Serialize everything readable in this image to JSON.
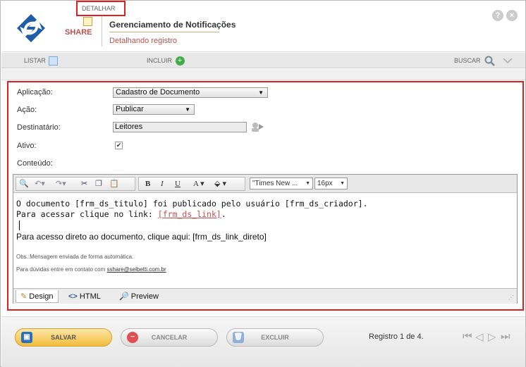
{
  "header": {
    "brand": "SHARE",
    "title": "Gerenciamento de Notificações",
    "subtitle": "Detalhando registro",
    "help_icon": "help-circle-icon",
    "close_icon": "close-circle-icon"
  },
  "toolbar": {
    "tabs": [
      {
        "label": "LISTAR",
        "icon": "list-icon"
      },
      {
        "label": "DETALHAR",
        "icon": "edit-document-icon"
      },
      {
        "label": "INCLUIR",
        "icon": "add-circle-icon"
      }
    ],
    "search_label": "BUSCAR"
  },
  "form": {
    "aplicacao_label": "Aplicação:",
    "aplicacao_value": "Cadastro de Documento",
    "acao_label": "Ação:",
    "acao_value": "Publicar",
    "destinatario_label": "Destinatário:",
    "destinatario_value": "Leitores",
    "ativo_label": "Ativo:",
    "ativo_checked": "✔",
    "conteudo_label": "Conteúdo:"
  },
  "editor": {
    "font_select": "\"Times New ...",
    "size_select": "16px",
    "line1": "O documento [frm_ds_titulo] foi publicado pelo usuário [frm_ds_criador].",
    "line2_prefix": "Para acessar clique no link: ",
    "line2_link": "[frm_ds_link]",
    "line2_suffix": ".",
    "line4": "Para acesso direto ao documento, clique aqui: [frm_ds_link_direto]",
    "obs": "Obs.:Mensagem enviada de forma automática.",
    "contact_prefix": "Para dúvidas entre em contato com ",
    "contact_email": "sshare@selbetti.com.br",
    "mode_design": "Design",
    "mode_html": "HTML",
    "mode_preview": "Preview"
  },
  "footer": {
    "save": "SALVAR",
    "cancel": "CANCELAR",
    "delete": "EXCLUIR",
    "records": "Registro 1 de 4."
  },
  "colors": {
    "brand_red": "#c0504d",
    "highlight_red": "#e02020",
    "save_yellow": "#f2bc3c"
  }
}
